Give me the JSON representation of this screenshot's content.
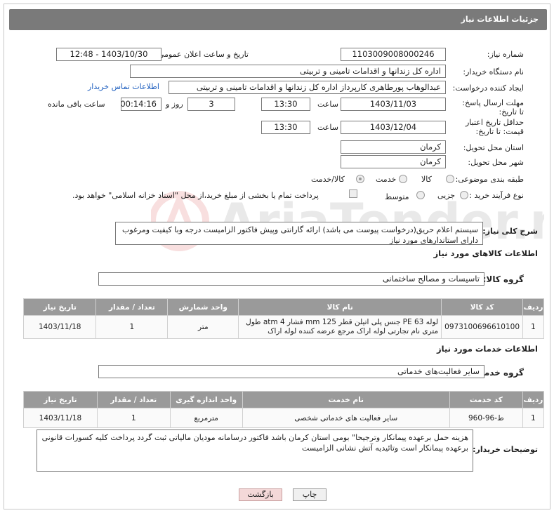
{
  "header": {
    "title": "جزئیات اطلاعات نیاز"
  },
  "form": {
    "need_number_label": "شماره نیاز:",
    "need_number": "1103009008000246",
    "announce_label": "تاریخ و ساعت اعلان عمومی:",
    "announce_value": "1403/10/30 - 12:48",
    "buyer_org_label": "نام دستگاه خریدار:",
    "buyer_org": "اداره کل زندانها و اقدامات تامینی و تربیتی",
    "creator_label": "ایجاد کننده درخواست:",
    "creator": "عبدالوهاب پورطاهری کارپرداز اداره کل زندانها و اقدامات تامینی و تربیتی",
    "contact_link": "اطلاعات تماس خریدار",
    "deadline_label": "مهلت ارسال پاسخ: تا تاریخ:",
    "deadline_date": "1403/11/03",
    "time_label": "ساعت",
    "deadline_time": "13:30",
    "days_count": "3",
    "days_label": "روز و",
    "remaining_time": "00:14:16",
    "remaining_label": "ساعت باقی مانده",
    "validity_label": "حداقل تاریخ اعتبار قیمت: تا تاریخ:",
    "validity_date": "1403/12/04",
    "validity_time": "13:30",
    "province_label": "استان محل تحویل:",
    "province": "کرمان",
    "city_label": "شهر محل تحویل:",
    "city": "کرمان",
    "category_label": "طبقه بندی موضوعی:",
    "category_options": [
      "کالا",
      "خدمت",
      "کالا/خدمت"
    ],
    "process_label": "نوع فرآیند خرید :",
    "process_options": [
      "جزیی",
      "متوسط"
    ],
    "payment_note": "پرداخت تمام یا بخشی از مبلغ خرید،از محل \"اسناد خزانه اسلامی\" خواهد بود."
  },
  "description": {
    "label": "شرح کلی نیاز:",
    "text": "سیستم اعلام حریق(درخواست پیوست می باشد) ارائه گارانتی وپیش فاکتور الزامیست درجه وبا کیفیت ومرغوب دارای استاندارهای مورد نیاز"
  },
  "goods": {
    "section_title": "اطلاعات کالاهای مورد نیاز",
    "group_label": "گروه کالا:",
    "group_value": "تاسیسات و مصالح ساختمانی",
    "columns": [
      "ردیف",
      "کد کالا",
      "نام کالا",
      "واحد شمارش",
      "تعداد / مقدار",
      "تاریخ نیاز"
    ],
    "rows": [
      {
        "row": "1",
        "code": "0973100696610100",
        "name": "لوله PE 63 جنس پلی اتیلن قطر 125 mm فشار 4 atm طول متری نام تجارتی لوله اراک مرجع عرضه کننده لوله اراک",
        "unit": "متر",
        "qty": "1",
        "date": "1403/11/18"
      }
    ]
  },
  "services": {
    "section_title": "اطلاعات خدمات مورد نیاز",
    "group_label": "گروه خدمت:",
    "group_value": "سایر فعالیت‌های خدماتی",
    "columns": [
      "ردیف",
      "کد خدمت",
      "نام خدمت",
      "واحد اندازه گیری",
      "تعداد / مقدار",
      "تاریخ نیاز"
    ],
    "rows": [
      {
        "row": "1",
        "code": "ط-96-960",
        "name": "سایر فعالیت های خدماتی شخصی",
        "unit": "مترمربع",
        "qty": "1",
        "date": "1403/11/18"
      }
    ]
  },
  "buyer_notes": {
    "label": "توضیحات خریدار:",
    "text": "هزینه حمل برعهده پیمانکار  وترجیحا\" بومی استان کرمان باشد فاکتور درسامانه مودیان مالیاتی ثبت گردد پرداخت کلیه کسورات قانونی برعهده پیمانکار است وتائیدیه آتش نشانی الزامیست"
  },
  "buttons": {
    "print": "چاپ",
    "back": "بازگشت"
  },
  "watermark_text": "AriaTender.net",
  "colors": {
    "header": "#7a7a7a",
    "table_header": "#9a9a9a",
    "link": "#1f5fbf",
    "back_button": "#f4d8d8"
  }
}
